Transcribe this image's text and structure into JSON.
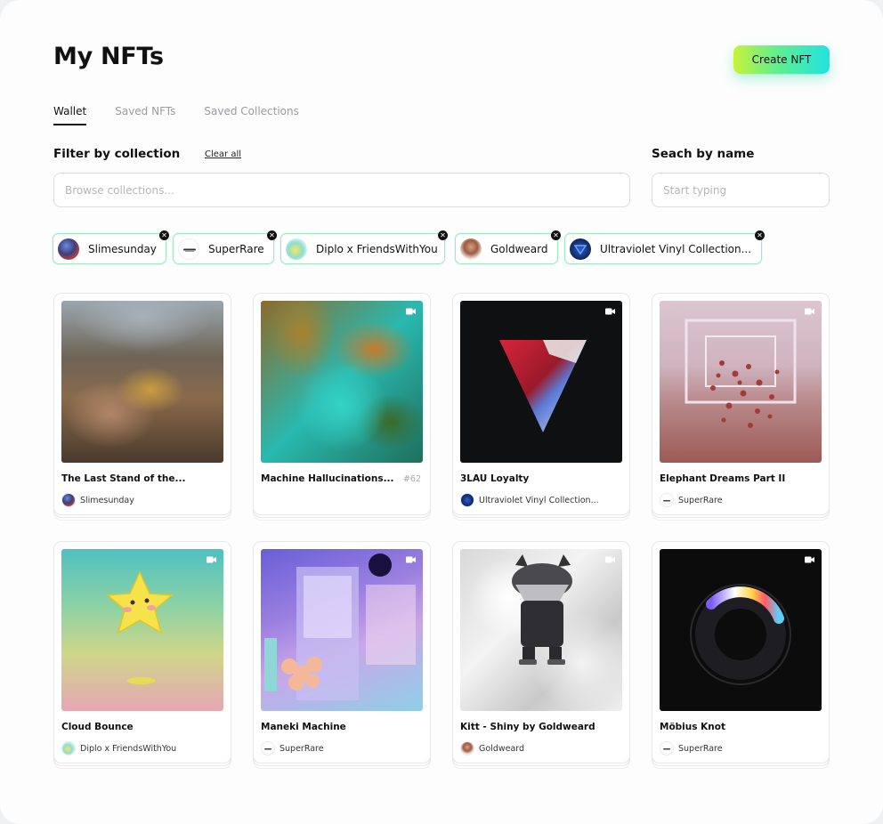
{
  "header": {
    "title": "My NFTs",
    "create_label": "Create NFT"
  },
  "tabs": [
    {
      "label": "Wallet",
      "active": true
    },
    {
      "label": "Saved NFTs",
      "active": false
    },
    {
      "label": "Saved Collections",
      "active": false
    }
  ],
  "filter": {
    "label": "Filter by collection",
    "clear_label": "Clear all",
    "placeholder": "Browse collections..."
  },
  "search": {
    "label": "Seach by name",
    "placeholder": "Start typing"
  },
  "chips": [
    {
      "label": "Slimesunday",
      "icon": "slimesunday-avatar-icon"
    },
    {
      "label": "SuperRare",
      "icon": "superrare-logo-icon"
    },
    {
      "label": "Diplo x FriendsWithYou",
      "icon": "diplo-avatar-icon"
    },
    {
      "label": "Goldweard",
      "icon": "goldweard-avatar-icon"
    },
    {
      "label": "Ultraviolet Vinyl Collection...",
      "icon": "ultraviolet-avatar-icon"
    }
  ],
  "nfts": [
    {
      "title": "The Last Stand of the...",
      "collection": "Slimesunday",
      "number": "",
      "video": false
    },
    {
      "title": "Machine Hallucinations...",
      "collection": "",
      "number": "#62",
      "video": true
    },
    {
      "title": "3LAU Loyalty",
      "collection": "Ultraviolet Vinyl Collection...",
      "number": "",
      "video": true
    },
    {
      "title": "Elephant Dreams Part II",
      "collection": "SuperRare",
      "number": "",
      "video": true
    },
    {
      "title": "Cloud Bounce",
      "collection": "Diplo x FriendsWithYou",
      "number": "",
      "video": true
    },
    {
      "title": "Maneki Machine",
      "collection": "SuperRare",
      "number": "",
      "video": true
    },
    {
      "title": "Kitt - Shiny by Goldweard",
      "collection": "Goldweard",
      "number": "",
      "video": true
    },
    {
      "title": "Möbius Knot",
      "collection": "SuperRare",
      "number": "",
      "video": true
    }
  ],
  "colors": {
    "accent_start": "#c8f23a",
    "accent_end": "#22e3e0",
    "chip_border": "#9fe8c0"
  }
}
